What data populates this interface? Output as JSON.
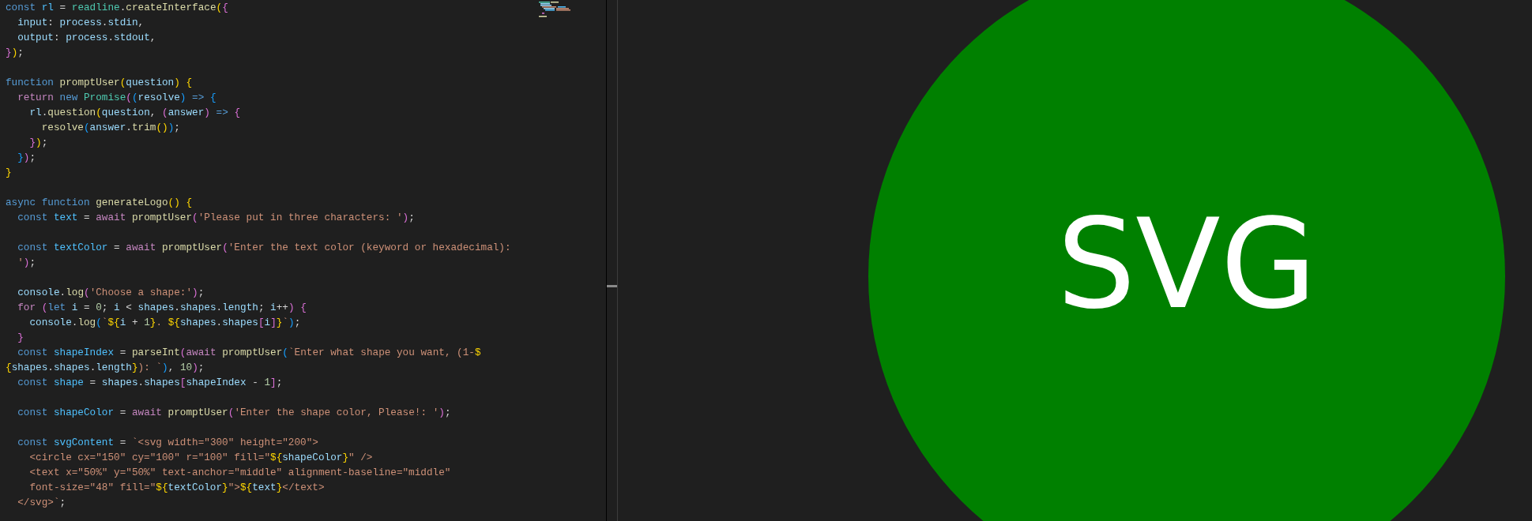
{
  "editor": {
    "lines": [
      {
        "kind": "code",
        "tokens": [
          {
            "text": "const",
            "kind": "kw"
          },
          {
            "text": " rl",
            "kind": "const"
          },
          {
            "text": " = ",
            "kind": "op"
          },
          {
            "text": "readline",
            "kind": "type"
          },
          {
            "text": ".",
            "kind": "op"
          },
          {
            "text": "createInterface",
            "kind": "fn"
          },
          {
            "text": "(",
            "kind": "b1"
          },
          {
            "text": "{",
            "kind": "b2"
          }
        ]
      },
      {
        "kind": "code",
        "tokens": [
          {
            "text": "  input",
            "kind": "var"
          },
          {
            "text": ": ",
            "kind": "op"
          },
          {
            "text": "process",
            "kind": "var"
          },
          {
            "text": ".",
            "kind": "op"
          },
          {
            "text": "stdin",
            "kind": "var"
          },
          {
            "text": ",",
            "kind": "op"
          }
        ]
      },
      {
        "kind": "code",
        "tokens": [
          {
            "text": "  output",
            "kind": "var"
          },
          {
            "text": ": ",
            "kind": "op"
          },
          {
            "text": "process",
            "kind": "var"
          },
          {
            "text": ".",
            "kind": "op"
          },
          {
            "text": "stdout",
            "kind": "var"
          },
          {
            "text": ",",
            "kind": "op"
          }
        ]
      },
      {
        "kind": "code",
        "tokens": [
          {
            "text": "}",
            "kind": "b2"
          },
          {
            "text": ")",
            "kind": "b1"
          },
          {
            "text": ";",
            "kind": "op"
          }
        ]
      },
      {
        "kind": "blank"
      },
      {
        "kind": "code",
        "tokens": [
          {
            "text": "function",
            "kind": "kw"
          },
          {
            "text": " promptUser",
            "kind": "fn"
          },
          {
            "text": "(",
            "kind": "b1"
          },
          {
            "text": "question",
            "kind": "var"
          },
          {
            "text": ")",
            "kind": "b1"
          },
          {
            "text": " {",
            "kind": "b1"
          }
        ]
      },
      {
        "kind": "code",
        "tokens": [
          {
            "text": "  return",
            "kind": "ctl"
          },
          {
            "text": " new",
            "kind": "kw"
          },
          {
            "text": " Promise",
            "kind": "type"
          },
          {
            "text": "(",
            "kind": "b2"
          },
          {
            "text": "(",
            "kind": "b3"
          },
          {
            "text": "resolve",
            "kind": "var"
          },
          {
            "text": ")",
            "kind": "b3"
          },
          {
            "text": " =>",
            "kind": "kw"
          },
          {
            "text": " {",
            "kind": "b3"
          }
        ]
      },
      {
        "kind": "code",
        "tokens": [
          {
            "text": "    rl",
            "kind": "var"
          },
          {
            "text": ".",
            "kind": "op"
          },
          {
            "text": "question",
            "kind": "fn"
          },
          {
            "text": "(",
            "kind": "b1"
          },
          {
            "text": "question",
            "kind": "var"
          },
          {
            "text": ", ",
            "kind": "op"
          },
          {
            "text": "(",
            "kind": "b2"
          },
          {
            "text": "answer",
            "kind": "var"
          },
          {
            "text": ")",
            "kind": "b2"
          },
          {
            "text": " =>",
            "kind": "kw"
          },
          {
            "text": " {",
            "kind": "b2"
          }
        ]
      },
      {
        "kind": "code",
        "tokens": [
          {
            "text": "      resolve",
            "kind": "fn"
          },
          {
            "text": "(",
            "kind": "b3"
          },
          {
            "text": "answer",
            "kind": "var"
          },
          {
            "text": ".",
            "kind": "op"
          },
          {
            "text": "trim",
            "kind": "fn"
          },
          {
            "text": "()",
            "kind": "b1"
          },
          {
            "text": ")",
            "kind": "b3"
          },
          {
            "text": ";",
            "kind": "op"
          }
        ]
      },
      {
        "kind": "code",
        "tokens": [
          {
            "text": "    }",
            "kind": "b2"
          },
          {
            "text": ")",
            "kind": "b1"
          },
          {
            "text": ";",
            "kind": "op"
          }
        ]
      },
      {
        "kind": "code",
        "tokens": [
          {
            "text": "  }",
            "kind": "b3"
          },
          {
            "text": ")",
            "kind": "b2"
          },
          {
            "text": ";",
            "kind": "op"
          }
        ]
      },
      {
        "kind": "code",
        "tokens": [
          {
            "text": "}",
            "kind": "b1"
          }
        ]
      },
      {
        "kind": "blank"
      },
      {
        "kind": "code",
        "tokens": [
          {
            "text": "async",
            "kind": "kw"
          },
          {
            "text": " function",
            "kind": "kw"
          },
          {
            "text": " generateLogo",
            "kind": "fn"
          },
          {
            "text": "()",
            "kind": "b1"
          },
          {
            "text": " {",
            "kind": "b1"
          }
        ]
      },
      {
        "kind": "code",
        "tokens": [
          {
            "text": "  const",
            "kind": "kw"
          },
          {
            "text": " text",
            "kind": "const"
          },
          {
            "text": " = ",
            "kind": "op"
          },
          {
            "text": "await",
            "kind": "ctl"
          },
          {
            "text": " promptUser",
            "kind": "fn"
          },
          {
            "text": "(",
            "kind": "b2"
          },
          {
            "text": "'Please put in three characters: '",
            "kind": "str"
          },
          {
            "text": ")",
            "kind": "b2"
          },
          {
            "text": ";",
            "kind": "op"
          }
        ]
      },
      {
        "kind": "blank"
      },
      {
        "kind": "code",
        "tokens": [
          {
            "text": "  const",
            "kind": "kw"
          },
          {
            "text": " textColor",
            "kind": "const"
          },
          {
            "text": " = ",
            "kind": "op"
          },
          {
            "text": "await",
            "kind": "ctl"
          },
          {
            "text": " promptUser",
            "kind": "fn"
          },
          {
            "text": "(",
            "kind": "b2"
          },
          {
            "text": "'Enter the text color (keyword or hexadecimal):",
            "kind": "str"
          }
        ]
      },
      {
        "kind": "code",
        "tokens": [
          {
            "text": "  '",
            "kind": "str"
          },
          {
            "text": ")",
            "kind": "b2"
          },
          {
            "text": ";",
            "kind": "op"
          }
        ]
      },
      {
        "kind": "blank"
      },
      {
        "kind": "code",
        "tokens": [
          {
            "text": "  console",
            "kind": "var"
          },
          {
            "text": ".",
            "kind": "op"
          },
          {
            "text": "log",
            "kind": "fn"
          },
          {
            "text": "(",
            "kind": "b2"
          },
          {
            "text": "'Choose a shape:'",
            "kind": "str"
          },
          {
            "text": ")",
            "kind": "b2"
          },
          {
            "text": ";",
            "kind": "op"
          }
        ]
      },
      {
        "kind": "code",
        "tokens": [
          {
            "text": "  for",
            "kind": "ctl"
          },
          {
            "text": " (",
            "kind": "b2"
          },
          {
            "text": "let",
            "kind": "kw"
          },
          {
            "text": " i",
            "kind": "var"
          },
          {
            "text": " = ",
            "kind": "op"
          },
          {
            "text": "0",
            "kind": "num"
          },
          {
            "text": "; ",
            "kind": "op"
          },
          {
            "text": "i",
            "kind": "var"
          },
          {
            "text": " < ",
            "kind": "op"
          },
          {
            "text": "shapes",
            "kind": "var"
          },
          {
            "text": ".",
            "kind": "op"
          },
          {
            "text": "shapes",
            "kind": "var"
          },
          {
            "text": ".",
            "kind": "op"
          },
          {
            "text": "length",
            "kind": "var"
          },
          {
            "text": "; ",
            "kind": "op"
          },
          {
            "text": "i",
            "kind": "var"
          },
          {
            "text": "++",
            "kind": "op"
          },
          {
            "text": ")",
            "kind": "b2"
          },
          {
            "text": " {",
            "kind": "b2"
          }
        ]
      },
      {
        "kind": "code",
        "tokens": [
          {
            "text": "    console",
            "kind": "var"
          },
          {
            "text": ".",
            "kind": "op"
          },
          {
            "text": "log",
            "kind": "fn"
          },
          {
            "text": "(",
            "kind": "b3"
          },
          {
            "text": "`",
            "kind": "str"
          },
          {
            "text": "${",
            "kind": "b1"
          },
          {
            "text": "i",
            "kind": "var"
          },
          {
            "text": " + ",
            "kind": "op"
          },
          {
            "text": "1",
            "kind": "num"
          },
          {
            "text": "}",
            "kind": "b1"
          },
          {
            "text": ". ",
            "kind": "str"
          },
          {
            "text": "${",
            "kind": "b1"
          },
          {
            "text": "shapes",
            "kind": "var"
          },
          {
            "text": ".",
            "kind": "op"
          },
          {
            "text": "shapes",
            "kind": "var"
          },
          {
            "text": "[",
            "kind": "b2"
          },
          {
            "text": "i",
            "kind": "var"
          },
          {
            "text": "]",
            "kind": "b2"
          },
          {
            "text": "}",
            "kind": "b1"
          },
          {
            "text": "`",
            "kind": "str"
          },
          {
            "text": ")",
            "kind": "b3"
          },
          {
            "text": ";",
            "kind": "op"
          }
        ]
      },
      {
        "kind": "code",
        "tokens": [
          {
            "text": "  }",
            "kind": "b2"
          }
        ]
      },
      {
        "kind": "code",
        "tokens": [
          {
            "text": "  const",
            "kind": "kw"
          },
          {
            "text": " shapeIndex",
            "kind": "const"
          },
          {
            "text": " = ",
            "kind": "op"
          },
          {
            "text": "parseInt",
            "kind": "fn"
          },
          {
            "text": "(",
            "kind": "b2"
          },
          {
            "text": "await",
            "kind": "ctl"
          },
          {
            "text": " promptUser",
            "kind": "fn"
          },
          {
            "text": "(",
            "kind": "b3"
          },
          {
            "text": "`Enter what shape you want, (1-",
            "kind": "str"
          },
          {
            "text": "$",
            "kind": "b1"
          }
        ]
      },
      {
        "kind": "code",
        "tokens": [
          {
            "text": "{",
            "kind": "b1"
          },
          {
            "text": "shapes",
            "kind": "var"
          },
          {
            "text": ".",
            "kind": "op"
          },
          {
            "text": "shapes",
            "kind": "var"
          },
          {
            "text": ".",
            "kind": "op"
          },
          {
            "text": "length",
            "kind": "var"
          },
          {
            "text": "}",
            "kind": "b1"
          },
          {
            "text": "): `",
            "kind": "str"
          },
          {
            "text": ")",
            "kind": "b3"
          },
          {
            "text": ", ",
            "kind": "op"
          },
          {
            "text": "10",
            "kind": "num"
          },
          {
            "text": ")",
            "kind": "b2"
          },
          {
            "text": ";",
            "kind": "op"
          }
        ]
      },
      {
        "kind": "code",
        "tokens": [
          {
            "text": "  const",
            "kind": "kw"
          },
          {
            "text": " shape",
            "kind": "const"
          },
          {
            "text": " = ",
            "kind": "op"
          },
          {
            "text": "shapes",
            "kind": "var"
          },
          {
            "text": ".",
            "kind": "op"
          },
          {
            "text": "shapes",
            "kind": "var"
          },
          {
            "text": "[",
            "kind": "b2"
          },
          {
            "text": "shapeIndex",
            "kind": "var"
          },
          {
            "text": " - ",
            "kind": "op"
          },
          {
            "text": "1",
            "kind": "num"
          },
          {
            "text": "]",
            "kind": "b2"
          },
          {
            "text": ";",
            "kind": "op"
          }
        ]
      },
      {
        "kind": "blank"
      },
      {
        "kind": "code",
        "tokens": [
          {
            "text": "  const",
            "kind": "kw"
          },
          {
            "text": " shapeColor",
            "kind": "const"
          },
          {
            "text": " = ",
            "kind": "op"
          },
          {
            "text": "await",
            "kind": "ctl"
          },
          {
            "text": " promptUser",
            "kind": "fn"
          },
          {
            "text": "(",
            "kind": "b2"
          },
          {
            "text": "'Enter the shape color, Please!: '",
            "kind": "str"
          },
          {
            "text": ")",
            "kind": "b2"
          },
          {
            "text": ";",
            "kind": "op"
          }
        ]
      },
      {
        "kind": "blank"
      },
      {
        "kind": "code",
        "tokens": [
          {
            "text": "  const",
            "kind": "kw"
          },
          {
            "text": " svgContent",
            "kind": "const"
          },
          {
            "text": " = ",
            "kind": "op"
          },
          {
            "text": "`<svg width=\"300\" height=\"200\">",
            "kind": "str"
          }
        ]
      },
      {
        "kind": "code",
        "tokens": [
          {
            "text": "    <circle cx=\"150\" cy=\"100\" r=\"100\" fill=\"",
            "kind": "str"
          },
          {
            "text": "${",
            "kind": "b1"
          },
          {
            "text": "shapeColor",
            "kind": "var"
          },
          {
            "text": "}",
            "kind": "b1"
          },
          {
            "text": "\" />",
            "kind": "str"
          }
        ]
      },
      {
        "kind": "code",
        "tokens": [
          {
            "text": "    <text x=\"50%\" y=\"50%\" text-anchor=\"middle\" alignment-baseline=\"middle\"",
            "kind": "str"
          }
        ]
      },
      {
        "kind": "code",
        "tokens": [
          {
            "text": "    font-size=\"48\" fill=\"",
            "kind": "str"
          },
          {
            "text": "${",
            "kind": "b1"
          },
          {
            "text": "textColor",
            "kind": "var"
          },
          {
            "text": "}",
            "kind": "b1"
          },
          {
            "text": "\">",
            "kind": "str"
          },
          {
            "text": "${",
            "kind": "b1"
          },
          {
            "text": "text",
            "kind": "var"
          },
          {
            "text": "}",
            "kind": "b1"
          },
          {
            "text": "</text>",
            "kind": "str"
          }
        ]
      },
      {
        "kind": "code",
        "tokens": [
          {
            "text": "  </svg>`",
            "kind": "str"
          },
          {
            "text": ";",
            "kind": "op"
          }
        ]
      }
    ]
  },
  "preview": {
    "text": "SVG"
  }
}
